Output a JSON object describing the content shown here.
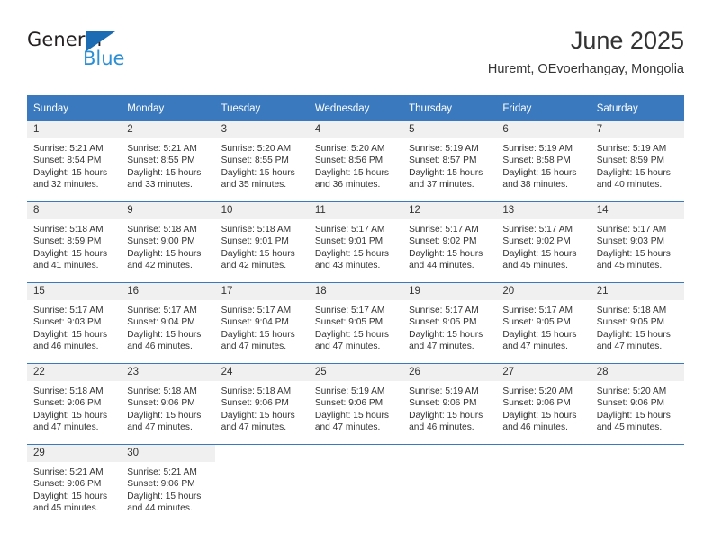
{
  "brand": {
    "name_part1": "General",
    "name_part2": "Blue",
    "triangle_icon": "blue-triangle-logo-mark",
    "accent_color": "#2b8fd6",
    "dark_color": "#231f20"
  },
  "header": {
    "title": "June 2025",
    "subtitle": "Huremt, OEvoerhangay, Mongolia"
  },
  "calendar": {
    "header_bg_color": "#3a79bd",
    "daynum_bg_color": "#f0f0f0",
    "weekdays": [
      "Sunday",
      "Monday",
      "Tuesday",
      "Wednesday",
      "Thursday",
      "Friday",
      "Saturday"
    ],
    "weeks": [
      [
        {
          "day": "1",
          "sunrise": "Sunrise: 5:21 AM",
          "sunset": "Sunset: 8:54 PM",
          "daylight_line1": "Daylight: 15 hours",
          "daylight_line2": "and 32 minutes."
        },
        {
          "day": "2",
          "sunrise": "Sunrise: 5:21 AM",
          "sunset": "Sunset: 8:55 PM",
          "daylight_line1": "Daylight: 15 hours",
          "daylight_line2": "and 33 minutes."
        },
        {
          "day": "3",
          "sunrise": "Sunrise: 5:20 AM",
          "sunset": "Sunset: 8:55 PM",
          "daylight_line1": "Daylight: 15 hours",
          "daylight_line2": "and 35 minutes."
        },
        {
          "day": "4",
          "sunrise": "Sunrise: 5:20 AM",
          "sunset": "Sunset: 8:56 PM",
          "daylight_line1": "Daylight: 15 hours",
          "daylight_line2": "and 36 minutes."
        },
        {
          "day": "5",
          "sunrise": "Sunrise: 5:19 AM",
          "sunset": "Sunset: 8:57 PM",
          "daylight_line1": "Daylight: 15 hours",
          "daylight_line2": "and 37 minutes."
        },
        {
          "day": "6",
          "sunrise": "Sunrise: 5:19 AM",
          "sunset": "Sunset: 8:58 PM",
          "daylight_line1": "Daylight: 15 hours",
          "daylight_line2": "and 38 minutes."
        },
        {
          "day": "7",
          "sunrise": "Sunrise: 5:19 AM",
          "sunset": "Sunset: 8:59 PM",
          "daylight_line1": "Daylight: 15 hours",
          "daylight_line2": "and 40 minutes."
        }
      ],
      [
        {
          "day": "8",
          "sunrise": "Sunrise: 5:18 AM",
          "sunset": "Sunset: 8:59 PM",
          "daylight_line1": "Daylight: 15 hours",
          "daylight_line2": "and 41 minutes."
        },
        {
          "day": "9",
          "sunrise": "Sunrise: 5:18 AM",
          "sunset": "Sunset: 9:00 PM",
          "daylight_line1": "Daylight: 15 hours",
          "daylight_line2": "and 42 minutes."
        },
        {
          "day": "10",
          "sunrise": "Sunrise: 5:18 AM",
          "sunset": "Sunset: 9:01 PM",
          "daylight_line1": "Daylight: 15 hours",
          "daylight_line2": "and 42 minutes."
        },
        {
          "day": "11",
          "sunrise": "Sunrise: 5:17 AM",
          "sunset": "Sunset: 9:01 PM",
          "daylight_line1": "Daylight: 15 hours",
          "daylight_line2": "and 43 minutes."
        },
        {
          "day": "12",
          "sunrise": "Sunrise: 5:17 AM",
          "sunset": "Sunset: 9:02 PM",
          "daylight_line1": "Daylight: 15 hours",
          "daylight_line2": "and 44 minutes."
        },
        {
          "day": "13",
          "sunrise": "Sunrise: 5:17 AM",
          "sunset": "Sunset: 9:02 PM",
          "daylight_line1": "Daylight: 15 hours",
          "daylight_line2": "and 45 minutes."
        },
        {
          "day": "14",
          "sunrise": "Sunrise: 5:17 AM",
          "sunset": "Sunset: 9:03 PM",
          "daylight_line1": "Daylight: 15 hours",
          "daylight_line2": "and 45 minutes."
        }
      ],
      [
        {
          "day": "15",
          "sunrise": "Sunrise: 5:17 AM",
          "sunset": "Sunset: 9:03 PM",
          "daylight_line1": "Daylight: 15 hours",
          "daylight_line2": "and 46 minutes."
        },
        {
          "day": "16",
          "sunrise": "Sunrise: 5:17 AM",
          "sunset": "Sunset: 9:04 PM",
          "daylight_line1": "Daylight: 15 hours",
          "daylight_line2": "and 46 minutes."
        },
        {
          "day": "17",
          "sunrise": "Sunrise: 5:17 AM",
          "sunset": "Sunset: 9:04 PM",
          "daylight_line1": "Daylight: 15 hours",
          "daylight_line2": "and 47 minutes."
        },
        {
          "day": "18",
          "sunrise": "Sunrise: 5:17 AM",
          "sunset": "Sunset: 9:05 PM",
          "daylight_line1": "Daylight: 15 hours",
          "daylight_line2": "and 47 minutes."
        },
        {
          "day": "19",
          "sunrise": "Sunrise: 5:17 AM",
          "sunset": "Sunset: 9:05 PM",
          "daylight_line1": "Daylight: 15 hours",
          "daylight_line2": "and 47 minutes."
        },
        {
          "day": "20",
          "sunrise": "Sunrise: 5:17 AM",
          "sunset": "Sunset: 9:05 PM",
          "daylight_line1": "Daylight: 15 hours",
          "daylight_line2": "and 47 minutes."
        },
        {
          "day": "21",
          "sunrise": "Sunrise: 5:18 AM",
          "sunset": "Sunset: 9:05 PM",
          "daylight_line1": "Daylight: 15 hours",
          "daylight_line2": "and 47 minutes."
        }
      ],
      [
        {
          "day": "22",
          "sunrise": "Sunrise: 5:18 AM",
          "sunset": "Sunset: 9:06 PM",
          "daylight_line1": "Daylight: 15 hours",
          "daylight_line2": "and 47 minutes."
        },
        {
          "day": "23",
          "sunrise": "Sunrise: 5:18 AM",
          "sunset": "Sunset: 9:06 PM",
          "daylight_line1": "Daylight: 15 hours",
          "daylight_line2": "and 47 minutes."
        },
        {
          "day": "24",
          "sunrise": "Sunrise: 5:18 AM",
          "sunset": "Sunset: 9:06 PM",
          "daylight_line1": "Daylight: 15 hours",
          "daylight_line2": "and 47 minutes."
        },
        {
          "day": "25",
          "sunrise": "Sunrise: 5:19 AM",
          "sunset": "Sunset: 9:06 PM",
          "daylight_line1": "Daylight: 15 hours",
          "daylight_line2": "and 47 minutes."
        },
        {
          "day": "26",
          "sunrise": "Sunrise: 5:19 AM",
          "sunset": "Sunset: 9:06 PM",
          "daylight_line1": "Daylight: 15 hours",
          "daylight_line2": "and 46 minutes."
        },
        {
          "day": "27",
          "sunrise": "Sunrise: 5:20 AM",
          "sunset": "Sunset: 9:06 PM",
          "daylight_line1": "Daylight: 15 hours",
          "daylight_line2": "and 46 minutes."
        },
        {
          "day": "28",
          "sunrise": "Sunrise: 5:20 AM",
          "sunset": "Sunset: 9:06 PM",
          "daylight_line1": "Daylight: 15 hours",
          "daylight_line2": "and 45 minutes."
        }
      ],
      [
        {
          "day": "29",
          "sunrise": "Sunrise: 5:21 AM",
          "sunset": "Sunset: 9:06 PM",
          "daylight_line1": "Daylight: 15 hours",
          "daylight_line2": "and 45 minutes."
        },
        {
          "day": "30",
          "sunrise": "Sunrise: 5:21 AM",
          "sunset": "Sunset: 9:06 PM",
          "daylight_line1": "Daylight: 15 hours",
          "daylight_line2": "and 44 minutes."
        },
        {
          "day": "",
          "sunrise": "",
          "sunset": "",
          "daylight_line1": "",
          "daylight_line2": ""
        },
        {
          "day": "",
          "sunrise": "",
          "sunset": "",
          "daylight_line1": "",
          "daylight_line2": ""
        },
        {
          "day": "",
          "sunrise": "",
          "sunset": "",
          "daylight_line1": "",
          "daylight_line2": ""
        },
        {
          "day": "",
          "sunrise": "",
          "sunset": "",
          "daylight_line1": "",
          "daylight_line2": ""
        },
        {
          "day": "",
          "sunrise": "",
          "sunset": "",
          "daylight_line1": "",
          "daylight_line2": ""
        }
      ]
    ]
  }
}
